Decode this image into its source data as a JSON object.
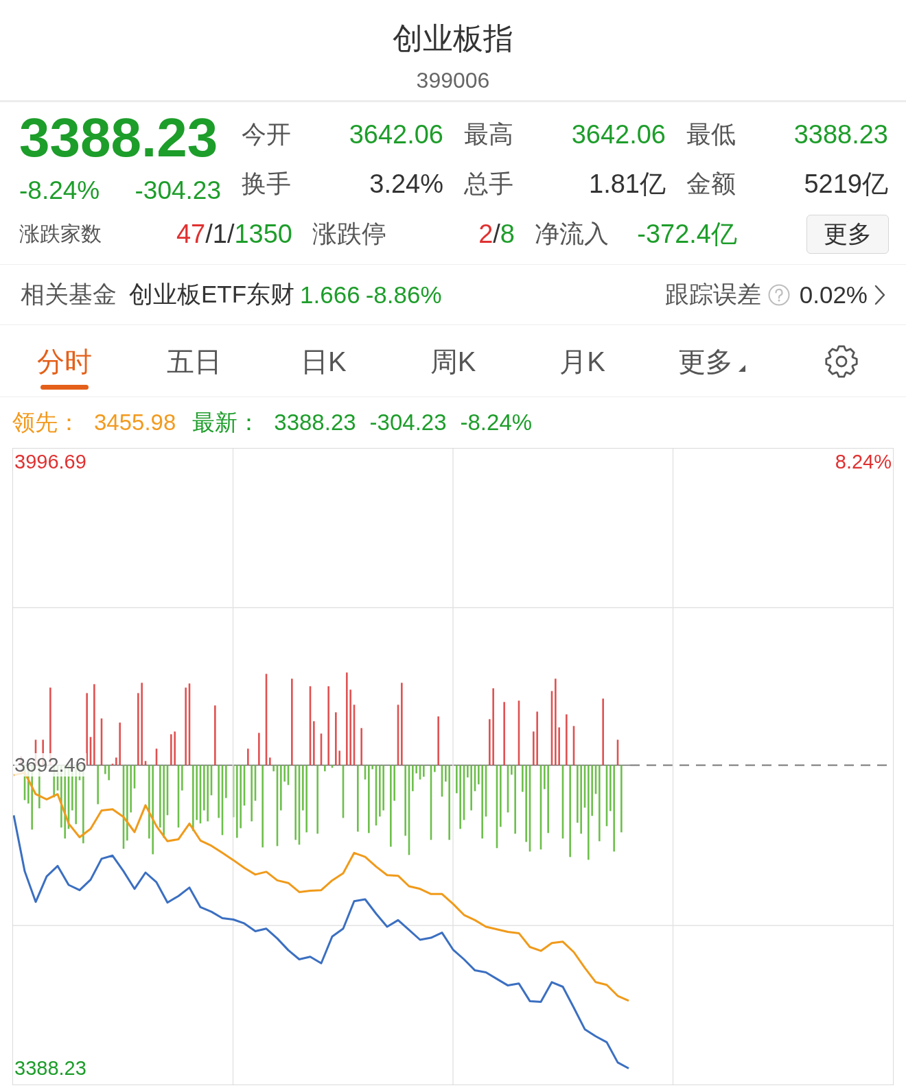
{
  "header": {
    "title": "创业板指",
    "code": "399006"
  },
  "quote": {
    "price": "3388.23",
    "change_percent": "-8.24%",
    "change": "-304.23",
    "color": "#1d9d2a",
    "stats": [
      {
        "label": "今开",
        "value": "3642.06",
        "color": "#1d9d2a"
      },
      {
        "label": "最高",
        "value": "3642.06",
        "color": "#1d9d2a"
      },
      {
        "label": "最低",
        "value": "3388.23",
        "color": "#1d9d2a"
      },
      {
        "label": "换手",
        "value": "3.24%",
        "color": "#333333"
      },
      {
        "label": "总手",
        "value": "1.81亿",
        "color": "#333333"
      },
      {
        "label": "金额",
        "value": "5219亿",
        "color": "#333333"
      }
    ],
    "breadth": [
      {
        "label": "涨跌家数",
        "parts": [
          {
            "text": "47",
            "color": "#e03131"
          },
          {
            "text": "/1/",
            "color": "#333333"
          },
          {
            "text": "1350",
            "color": "#1d9d2a"
          }
        ]
      },
      {
        "label": "涨跌停",
        "parts": [
          {
            "text": "2",
            "color": "#e03131"
          },
          {
            "text": "/",
            "color": "#333333"
          },
          {
            "text": "8",
            "color": "#1d9d2a"
          }
        ]
      },
      {
        "label": "净流入",
        "parts": [
          {
            "text": "-372.4亿",
            "color": "#1d9d2a"
          }
        ]
      }
    ],
    "more_button": "更多"
  },
  "related_fund": {
    "label": "相关基金",
    "name": "创业板ETF东财",
    "price": "1.666",
    "change": "-8.86%",
    "color": "#1d9d2a",
    "tracking_label": "跟踪误差",
    "tracking_value": "0.02%"
  },
  "tabs": [
    {
      "label": "分时",
      "selected": true
    },
    {
      "label": "五日",
      "selected": false
    },
    {
      "label": "日K",
      "selected": false
    },
    {
      "label": "周K",
      "selected": false
    },
    {
      "label": "月K",
      "selected": false
    },
    {
      "label": "更多",
      "selected": false,
      "kind": "dropdown"
    }
  ],
  "chart": {
    "legend": [
      {
        "label": "领先：",
        "values": [
          "3455.98"
        ],
        "color": "#f29a1e"
      },
      {
        "label": "最新：",
        "values": [
          "3388.23",
          "-304.23",
          "-8.24%"
        ],
        "color": "#1d9d2a"
      }
    ],
    "percent_label": "8.24%",
    "chart_data": {
      "type": "line",
      "categories": [
        null,
        null,
        null,
        null,
        null,
        null,
        null,
        null,
        null,
        null,
        null,
        null,
        null,
        null,
        null,
        null,
        null,
        null,
        null,
        null,
        null,
        null,
        null,
        null,
        null,
        null,
        null,
        null,
        null,
        null,
        null,
        null,
        null,
        null,
        null,
        null,
        null,
        null,
        null,
        null,
        null,
        null,
        null,
        null,
        null,
        null,
        null,
        null,
        null,
        null,
        null,
        null,
        null,
        null,
        null,
        null,
        null,
        null,
        null,
        null,
        null,
        null,
        null,
        null,
        null,
        null,
        null,
        null,
        null,
        null,
        null,
        null,
        null,
        null,
        null,
        null,
        null,
        null,
        null,
        null,
        null
      ],
      "ylim": [
        3372,
        4010
      ],
      "yticks": [
        {
          "value": 3996.69,
          "label": "3996.69"
        },
        {
          "value": 3692.46,
          "label": "3692.46"
        },
        {
          "value": 3388.23,
          "label": "3388.23"
        }
      ],
      "grid": true,
      "series": [
        {
          "color": "#f09a1a",
          "values": [
            3682.3,
            3684.9,
            3663.3,
            3658.1,
            3663.3,
            3633.8,
            3620.1,
            3628.6,
            3646.9,
            3648.2,
            3640.4,
            3625.3,
            3652.2,
            3631.2,
            3616.1,
            3618.1,
            3633.8,
            3616.8,
            3611.6,
            3604.4,
            3597.1,
            3589.3,
            3582.7,
            3585.4,
            3576.8,
            3574.2,
            3565.1,
            3566.4,
            3567,
            3576.8,
            3584,
            3604.4,
            3600.4,
            3590.6,
            3582.1,
            3581.4,
            3570.9,
            3568.3,
            3563.1,
            3563.1,
            3553.3,
            3542.1,
            3536.9,
            3530.3,
            3527.7,
            3525.1,
            3523.8,
            3510,
            3506.1,
            3514,
            3515.3,
            3504.8,
            3489.1,
            3474.7,
            3472,
            3460.9,
            3456,
            null,
            null,
            null,
            null,
            null,
            null,
            null,
            null,
            null,
            null,
            null,
            null,
            null,
            null,
            null,
            null,
            null,
            null,
            null,
            null,
            null,
            null,
            null,
            null
          ]
        },
        {
          "color": "#3b6fc1",
          "values": [
            3642.1,
            3586,
            3555.2,
            3580.8,
            3591.3,
            3572.3,
            3567,
            3577.5,
            3598.5,
            3601.7,
            3586,
            3568.3,
            3584.7,
            3574.9,
            3554.6,
            3561.1,
            3569.6,
            3550,
            3545.4,
            3538.9,
            3537.5,
            3533.6,
            3525.8,
            3528.4,
            3518.5,
            3506.8,
            3497.6,
            3500.2,
            3493.7,
            3520.5,
            3528.4,
            3555.9,
            3557.8,
            3543.4,
            3530.3,
            3536.9,
            3527.1,
            3517.2,
            3519.2,
            3524.4,
            3507.4,
            3497.6,
            3486.5,
            3484.5,
            3477.9,
            3471.4,
            3473.4,
            3455.7,
            3455,
            3474.7,
            3470.1,
            3449.1,
            3427.5,
            3420.3,
            3414.4,
            3394.1,
            3388.2,
            null,
            null,
            null,
            null,
            null,
            null,
            null,
            null,
            null,
            null,
            null,
            null,
            null,
            null,
            null,
            null,
            null,
            null,
            null,
            null,
            null,
            null,
            null,
            null
          ]
        }
      ]
    }
  }
}
